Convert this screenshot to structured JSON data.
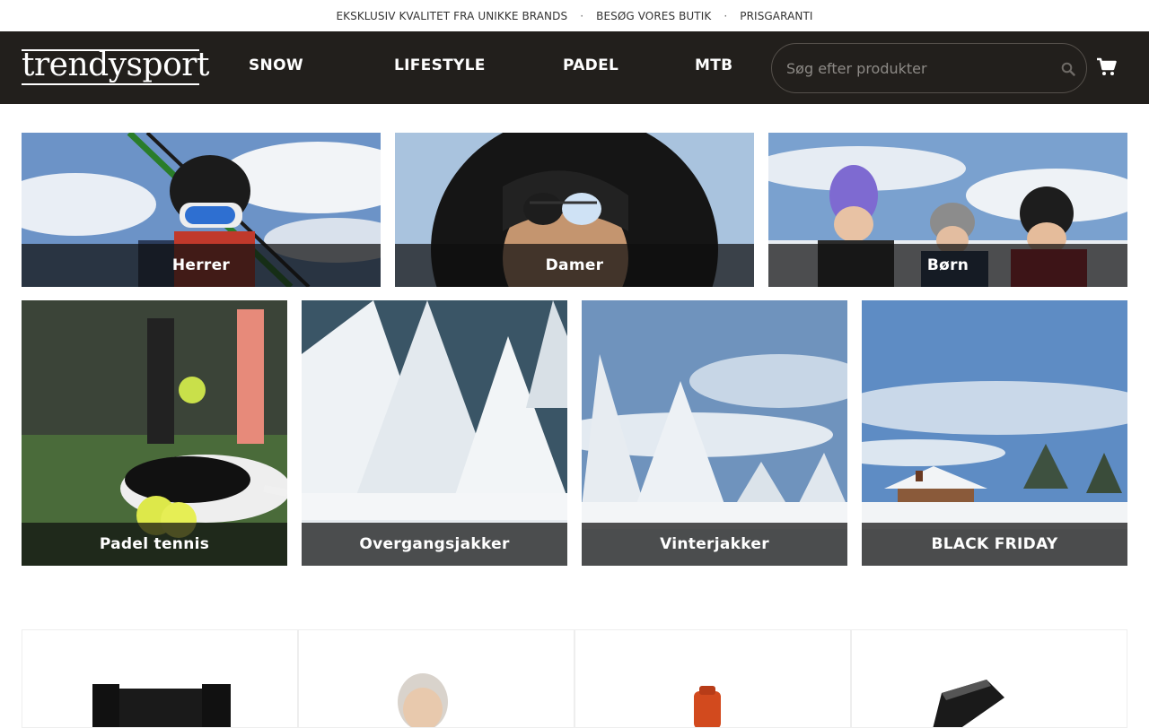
{
  "topbar": {
    "items": [
      "EKSKLUSIV KVALITET FRA UNIKKE BRANDS",
      "BESØG VORES BUTIK",
      "PRISGARANTI"
    ]
  },
  "header": {
    "logo": "trendysport",
    "nav": [
      "SNOW",
      "LIFESTYLE",
      "PADEL",
      "MTB"
    ],
    "search_placeholder": "Søg efter produkter"
  },
  "categories_row1": [
    {
      "label": "Herrer"
    },
    {
      "label": "Damer"
    },
    {
      "label": "Børn"
    }
  ],
  "categories_row2": [
    {
      "label": "Padel tennis"
    },
    {
      "label": "Overgangsjakker"
    },
    {
      "label": "Vinterjakker"
    },
    {
      "label": "BLACK FRIDAY"
    }
  ],
  "icons": {
    "search": "search-icon",
    "cart": "shopping-cart-icon"
  },
  "colors": {
    "header_bg": "#221f1c",
    "label_overlay": "#0f0f0f"
  }
}
